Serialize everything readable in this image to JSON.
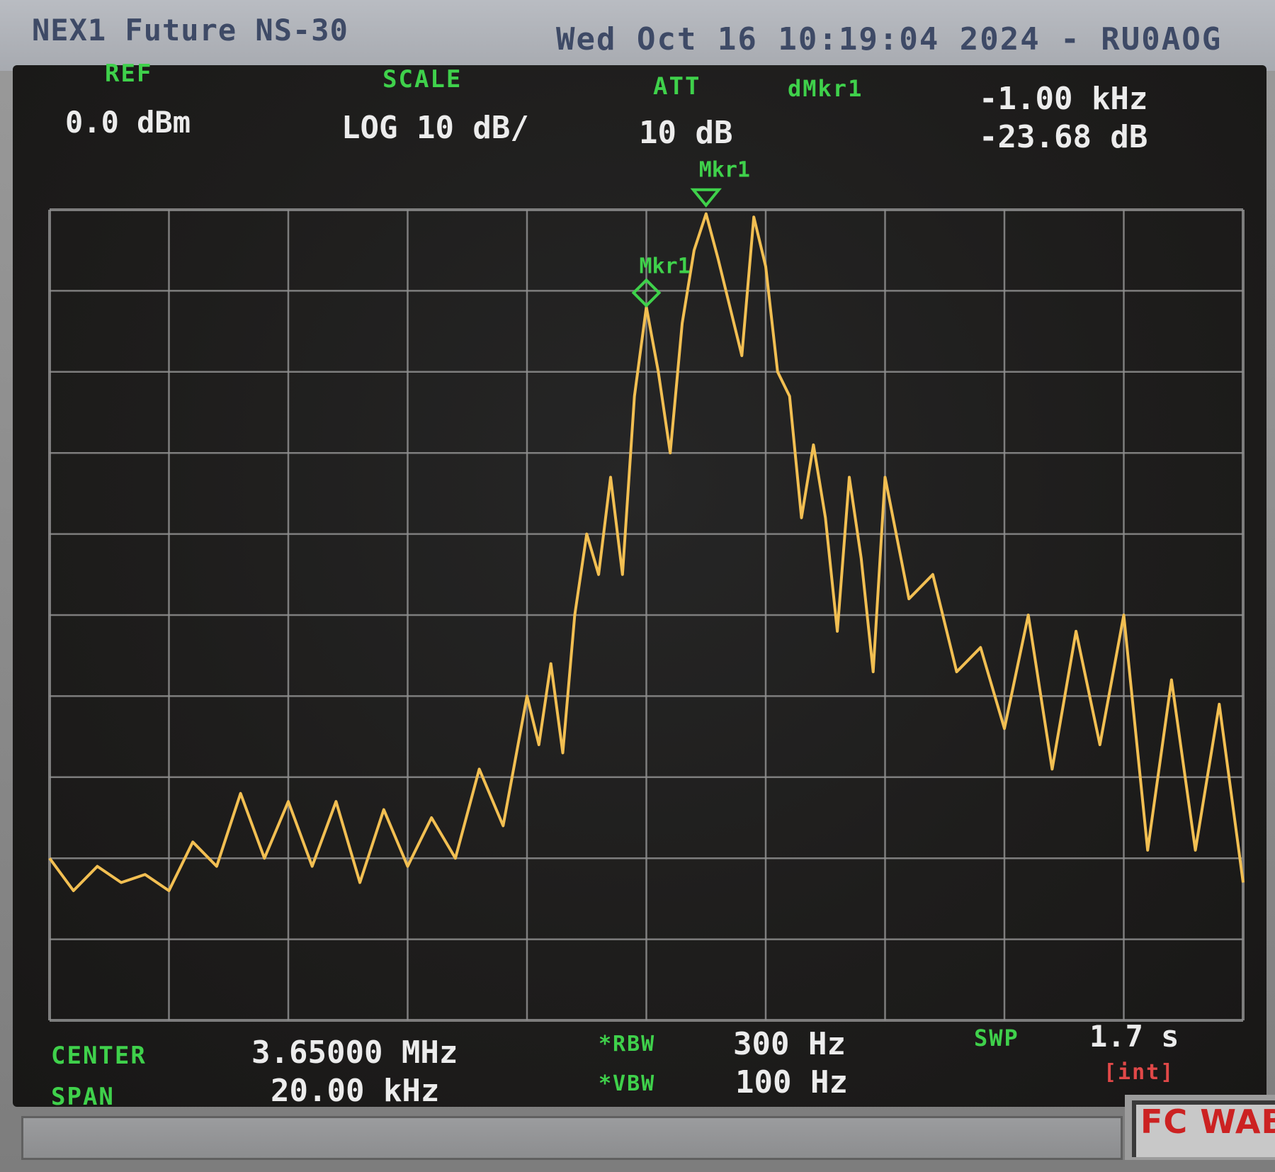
{
  "window": {
    "title": "NEX1 Future NS-30",
    "status": "Wed Oct 16 10:19:04 2024 - RU0AOG"
  },
  "header": {
    "ref_label": "REF",
    "ref_value": "0.0 dBm",
    "scale_label": "SCALE",
    "scale_value": "LOG 10 dB/",
    "att_label": "ATT",
    "att_value": "10 dB",
    "dmkr_label": "dMkr1",
    "dmkr_freq": "-1.00 kHz",
    "dmkr_level": "-23.68 dB"
  },
  "footer": {
    "center_label": "CENTER",
    "center_value": "3.65000 MHz",
    "span_label": "SPAN",
    "span_value": "20.00 kHz",
    "rbw_label": "*RBW",
    "rbw_value": "300 Hz",
    "vbw_label": "*VBW",
    "vbw_value": "100 Hz",
    "swp_label": "SWP",
    "swp_value": "1.7 s",
    "swp_mode": "[int]",
    "fc_label": "FC WABE"
  },
  "markers": {
    "ref_marker_label": "Mkr1",
    "delta_marker_label": "Mkr1"
  },
  "colors": {
    "trace": "#f2bf52",
    "grid": "#8f8f8f",
    "labels": "#3fd14b",
    "values": "#ececec",
    "warning": "#e04848"
  },
  "chart_data": {
    "type": "line",
    "title": "",
    "xlabel": "",
    "ylabel": "",
    "x_units": "kHz offset from center",
    "y_units": "dBm",
    "xlim": [
      -10,
      10
    ],
    "ylim": [
      -100,
      0
    ],
    "grid": true,
    "series": [
      {
        "x": [
          -10,
          -9.6,
          -9.2,
          -8.8,
          -8.4,
          -8.0,
          -7.6,
          -7.2,
          -6.8,
          -6.4,
          -6.0,
          -5.6,
          -5.2,
          -4.8,
          -4.4,
          -4.0,
          -3.6,
          -3.2,
          -2.8,
          -2.4,
          -2.0,
          -1.8,
          -1.6,
          -1.4,
          -1.2,
          -1.0,
          -0.8,
          -0.6,
          -0.4,
          -0.2,
          0.0,
          0.2,
          0.4,
          0.6,
          0.8,
          1.0,
          1.2,
          1.4,
          1.6,
          1.8,
          2.0,
          2.2,
          2.4,
          2.6,
          2.8,
          3.0,
          3.2,
          3.4,
          3.6,
          3.8,
          4.0,
          4.4,
          4.8,
          5.2,
          5.6,
          6.0,
          6.4,
          6.8,
          7.2,
          7.6,
          8.0,
          8.4,
          8.8,
          9.2,
          9.6,
          10.0
        ],
        "y": [
          -80,
          -84,
          -81,
          -83,
          -82,
          -84,
          -78,
          -81,
          -72,
          -80,
          -73,
          -81,
          -73,
          -83,
          -74,
          -81,
          -75,
          -80,
          -69,
          -76,
          -60,
          -66,
          -56,
          -67,
          -50,
          -40,
          -45,
          -33,
          -45,
          -23,
          -12,
          -20,
          -30,
          -14,
          -5,
          -0.5,
          -6,
          -12,
          -18,
          -0.9,
          -7,
          -20,
          -23,
          -38,
          -29,
          -38,
          -52,
          -33,
          -43,
          -57,
          -33,
          -48,
          -45,
          -57,
          -54,
          -64,
          -50,
          -69,
          -52,
          -66,
          -50,
          -79,
          -58,
          -79,
          -61,
          -83
        ]
      }
    ]
  }
}
